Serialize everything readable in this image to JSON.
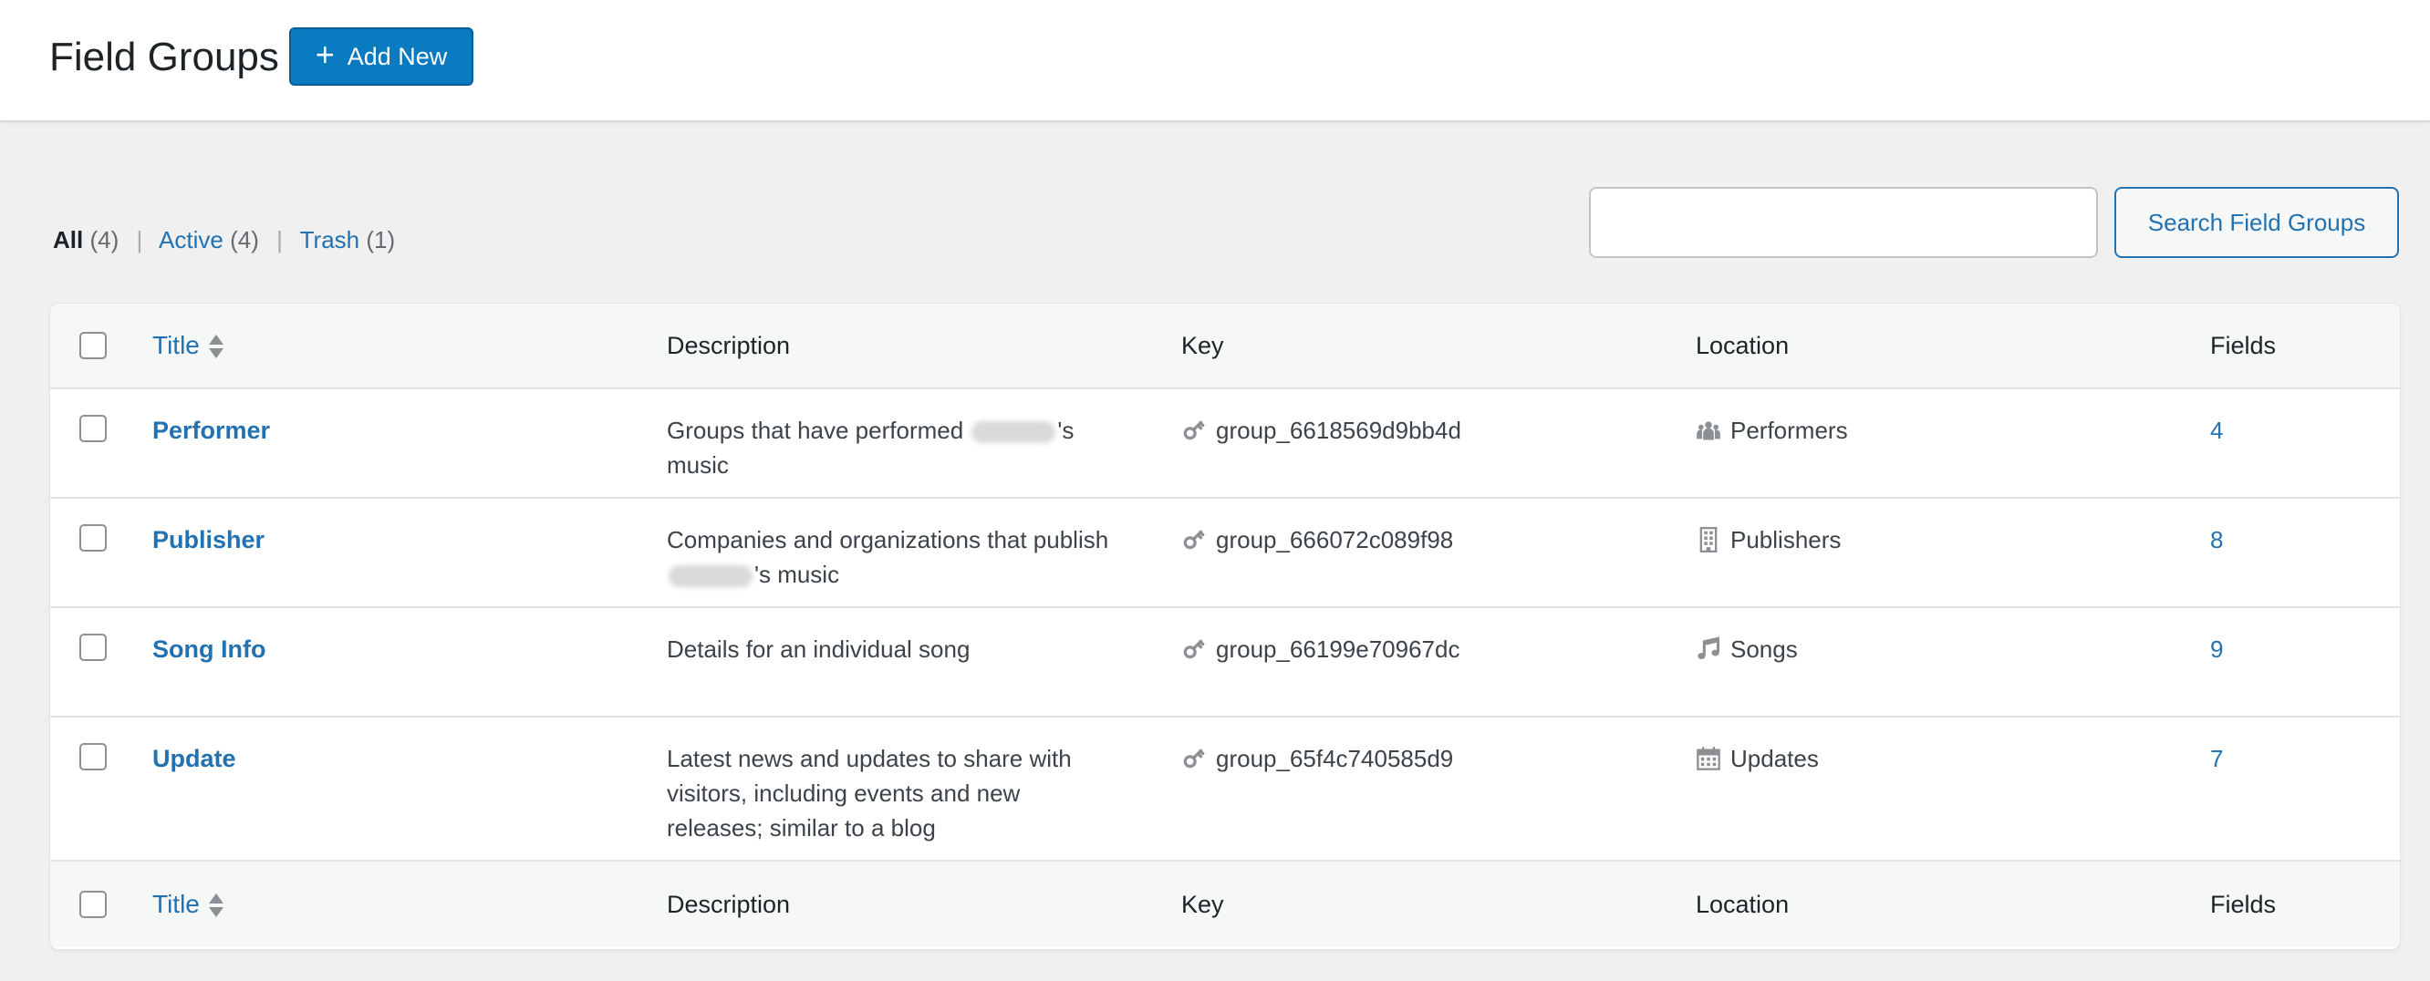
{
  "header": {
    "title": "Field Groups",
    "add_new_label": "Add New"
  },
  "filters": {
    "all": {
      "label": "All",
      "count": "(4)"
    },
    "active": {
      "label": "Active",
      "count": "(4)"
    },
    "trash": {
      "label": "Trash",
      "count": "(1)"
    },
    "separator": "|"
  },
  "search": {
    "value": "",
    "placeholder": "",
    "button_label": "Search Field Groups"
  },
  "columns": {
    "title": "Title",
    "description": "Description",
    "key": "Key",
    "location": "Location",
    "fields": "Fields"
  },
  "rows": [
    {
      "title": "Performer",
      "description_before": "Groups that have performed ",
      "description_after": "'s music",
      "description_redacted": true,
      "key": "group_6618569d9bb4d",
      "location": "Performers",
      "location_icon": "groups-icon",
      "fields": "4"
    },
    {
      "title": "Publisher",
      "description_before": "Companies and organizations that publish ",
      "description_after": "'s music",
      "description_redacted": true,
      "key": "group_666072c089f98",
      "location": "Publishers",
      "location_icon": "building-icon",
      "fields": "8"
    },
    {
      "title": "Song Info",
      "description_before": "Details for an individual song",
      "description_after": "",
      "description_redacted": false,
      "key": "group_66199e70967dc",
      "location": "Songs",
      "location_icon": "music-note-icon",
      "fields": "9"
    },
    {
      "title": "Update",
      "description_before": "Latest news and updates to share with visitors, including events and new releases; similar to a blog",
      "description_after": "",
      "description_redacted": false,
      "key": "group_65f4c740585d9",
      "location": "Updates",
      "location_icon": "calendar-icon",
      "fields": "7"
    }
  ],
  "colors": {
    "accent": "#2271b1",
    "primary_button": "#0a7bc1",
    "background": "#f0f0f1",
    "icon_gray": "#8c8f94"
  }
}
